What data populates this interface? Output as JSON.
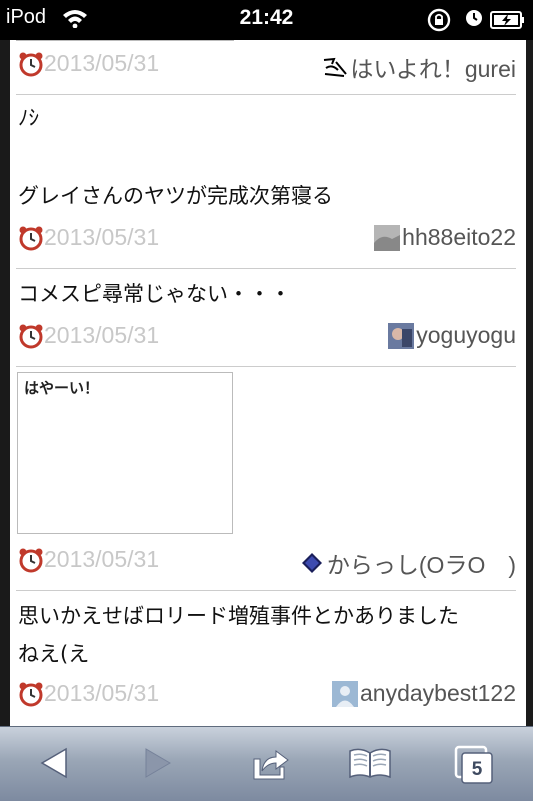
{
  "status_bar": {
    "carrier": "iPod",
    "time": "21:42"
  },
  "posts": [
    {
      "date": "2013/05/31",
      "user": "はいよれ！gurei",
      "avatar": "doodle-avatar",
      "message_lines": []
    },
    {
      "date": "2013/05/31",
      "user": "hh88eito22",
      "avatar": "gray-avatar",
      "message_lines": [
        "ﾉｼ",
        "",
        "グレイさんのヤツが完成次第寝る"
      ]
    },
    {
      "date": "2013/05/31",
      "user": "yoguyogu",
      "avatar": "photo-avatar",
      "message_lines": [
        "コメスピ尋常じゃない・・・"
      ]
    },
    {
      "date": "2013/05/31",
      "user": "からっし(OラO　)",
      "avatar": "diamond-avatar",
      "message_lines": [],
      "drawing_text": "はやーい！"
    },
    {
      "date": "2013/05/31",
      "user": "anydaybest122",
      "avatar": "default-person-avatar",
      "message_lines": [
        "思いかえせばロリード増殖事件とかありました",
        "ねえ(え"
      ]
    }
  ],
  "toolbar": {
    "tabs_count": "5",
    "icons": [
      "back-arrow-icon",
      "forward-arrow-icon",
      "share-icon",
      "bookmarks-icon",
      "tabs-icon"
    ]
  },
  "colors": {
    "date": "#c8c8c8",
    "toolbar_top": "#c9d1dc",
    "toolbar_bottom": "#7d8aa0"
  }
}
